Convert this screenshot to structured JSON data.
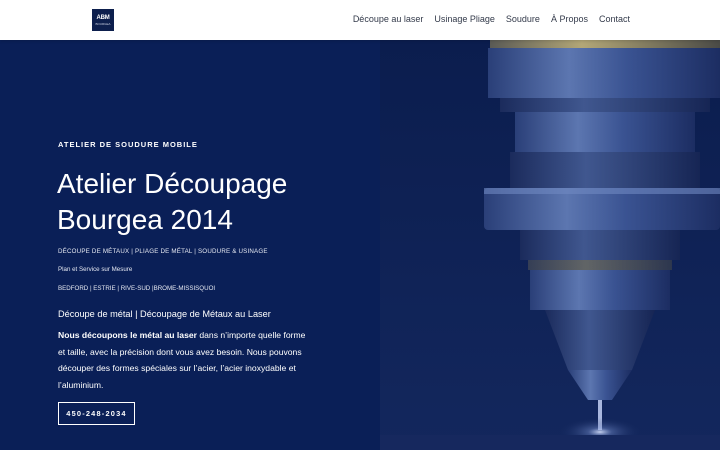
{
  "brand": {
    "logo_text": "ABM",
    "logo_sub": "BOURGEA"
  },
  "nav": {
    "items": [
      "Découpe au laser",
      "Usinage Pliage",
      "Soudure",
      "À Propos",
      "Contact"
    ]
  },
  "hero": {
    "eyebrow": "ATELIER DE SOUDURE MOBILE",
    "title": "Atelier Découpage Bourgea 2014",
    "services_line": "DÉCOUPE DE MÉTAUX | PLIAGE DE MÉTAL | SOUDURE & USINAGE",
    "plan_line": "Plan et Service sur Mesure",
    "regions_line": "BEDFORD | ESTRIE | RIVE-SUD |BROME-MISSISQUOI",
    "subheading": "Découpe de métal | Découpage de Métaux au Laser",
    "body_bold": "Nous découpons le métal au laser",
    "body_rest": " dans n’importe quelle forme et taille, avec la précision dont vous avez besoin. Nous pouvons découper des formes spéciales sur l’acier, l’acier inoxydable et l’aluminium.",
    "cta_label": "450-248-2034"
  },
  "colors": {
    "hero_bg": "#0a1f57",
    "image_bg": "#0a1b4a",
    "header_bg": "#ffffff",
    "nav_text": "#333a4a"
  },
  "image": {
    "subject": "laser-cutting-nozzle"
  }
}
